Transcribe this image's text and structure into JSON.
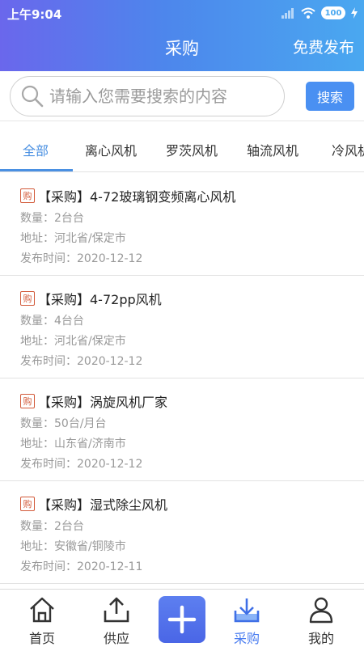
{
  "status_bar": {
    "time": "上午9:04",
    "battery": "100"
  },
  "header": {
    "title": "采购",
    "publish_label": "免费发布"
  },
  "search": {
    "placeholder": "请输入您需要搜索的内容",
    "button_label": "搜索"
  },
  "tabs": [
    "全部",
    "离心风机",
    "罗茨风机",
    "轴流风机",
    "冷风机"
  ],
  "tag_label": "购",
  "items": [
    {
      "title": "【采购】4-72玻璃钢变频离心风机",
      "quantity": "数量：2台台",
      "address": "地址：河北省/保定市",
      "date": "发布时间：2020-12-12"
    },
    {
      "title": "【采购】4-72pp风机",
      "quantity": "数量：4台台",
      "address": "地址：河北省/保定市",
      "date": "发布时间：2020-12-12"
    },
    {
      "title": "【采购】涡旋风机厂家",
      "quantity": "数量：50台/月台",
      "address": "地址：山东省/济南市",
      "date": "发布时间：2020-12-12"
    },
    {
      "title": "【采购】湿式除尘风机",
      "quantity": "数量：2台台",
      "address": "地址：安徽省/铜陵市",
      "date": "发布时间：2020-12-11"
    }
  ],
  "nav": [
    {
      "label": "首页",
      "icon": "home-icon"
    },
    {
      "label": "供应",
      "icon": "upload-icon"
    },
    {
      "label": "",
      "icon": "plus-icon"
    },
    {
      "label": "采购",
      "icon": "download-tray-icon"
    },
    {
      "label": "我的",
      "icon": "user-icon"
    }
  ],
  "colors": {
    "accent": "#4a90e2",
    "header_start": "#6a67ec",
    "header_end": "#4aa8f0",
    "tag": "#d25a3a"
  }
}
